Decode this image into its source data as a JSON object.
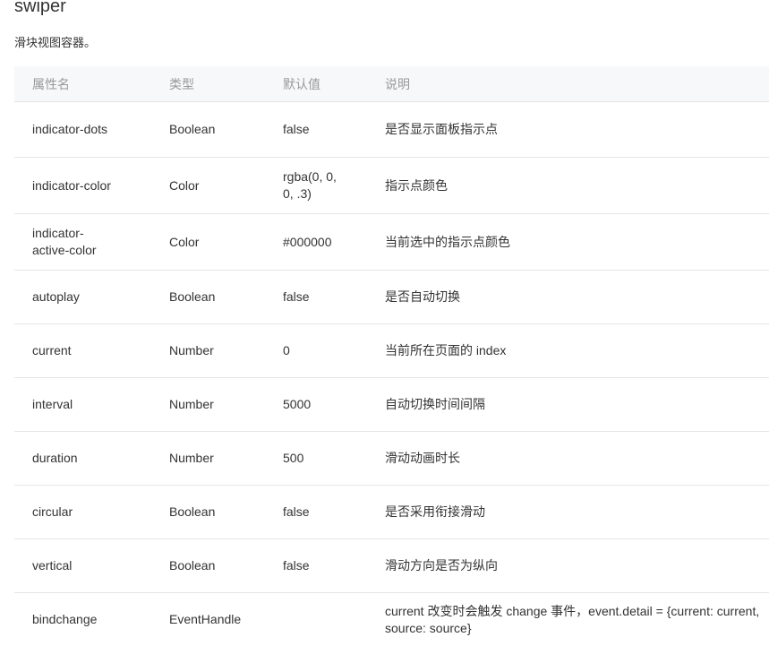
{
  "title": "swiper",
  "description": "滑块视图容器。",
  "headers": [
    "属性名",
    "类型",
    "默认值",
    "说明"
  ],
  "rows": [
    [
      "indicator-dots",
      "Boolean",
      "false",
      "是否显示面板指示点"
    ],
    [
      "indicator-color",
      "Color",
      "rgba(0, 0, 0, .3)",
      "指示点颜色"
    ],
    [
      "indicator-active-color",
      "Color",
      "#000000",
      "当前选中的指示点颜色"
    ],
    [
      "autoplay",
      "Boolean",
      "false",
      "是否自动切换"
    ],
    [
      "current",
      "Number",
      "0",
      "当前所在页面的 index"
    ],
    [
      "interval",
      "Number",
      "5000",
      "自动切换时间间隔"
    ],
    [
      "duration",
      "Number",
      "500",
      "滑动动画时长"
    ],
    [
      "circular",
      "Boolean",
      "false",
      "是否采用衔接滑动"
    ],
    [
      "vertical",
      "Boolean",
      "false",
      "滑动方向是否为纵向"
    ],
    [
      "bindchange",
      "EventHandle",
      "",
      "current 改变时会触发 change 事件，event.detail = {current: current, source: source}"
    ]
  ]
}
